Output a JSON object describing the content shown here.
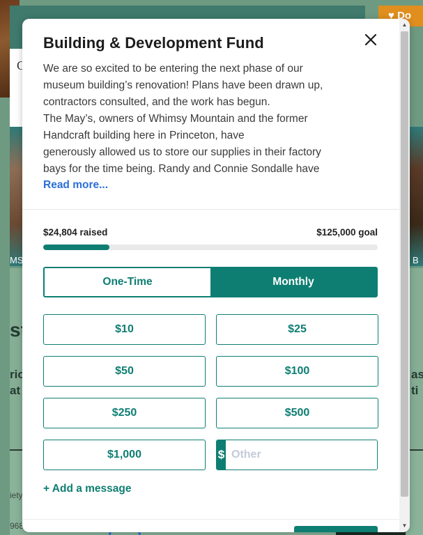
{
  "background": {
    "donate_label": "Do",
    "left_letter": "C",
    "left_label": "MS",
    "right_label": "B",
    "left_big": "st",
    "right_big": "",
    "left_mid_1": "rio",
    "left_mid_2": "at",
    "right_mid_1": "as",
    "right_mid_2": "ti",
    "bottom_small_1": "iety",
    "bottom_small_2": "968"
  },
  "modal": {
    "title": "Building & Development Fund",
    "description_lines": [
      "We are so excited to be entering the next phase of our",
      "museum building’s renovation! Plans have been drawn up,",
      "contractors consulted, and the work has begun.",
      "The May’s, owners of Whimsy Mountain and the former",
      "Handcraft building here in Princeton, have",
      "generously allowed us to store our supplies in their factory",
      "bays for the time being. Randy and Connie Sondalle have"
    ],
    "read_more": "Read more...",
    "raised": "$24,804 raised",
    "goal": "$125,000 goal",
    "progress_fraction": 0.198,
    "frequency": {
      "one_time": "One-Time",
      "monthly": "Monthly",
      "selected": "monthly"
    },
    "amounts": [
      "$10",
      "$25",
      "$50",
      "$100",
      "$250",
      "$500",
      "$1,000"
    ],
    "other": {
      "prefix": "$",
      "placeholder": "Other"
    },
    "add_message": "+ Add a message"
  },
  "colors": {
    "primary": "#0e7e72",
    "link": "#2a6fd6"
  }
}
